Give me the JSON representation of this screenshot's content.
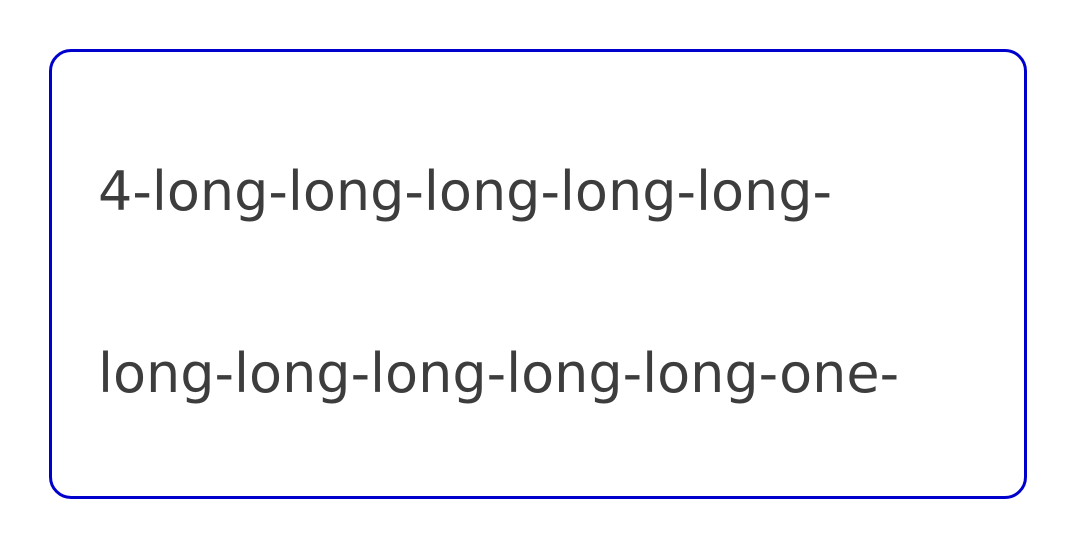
{
  "card": {
    "border_color": "#0000cc",
    "text_color": "#3d3d3d",
    "lines": [
      "4-long-long-long-long-long-",
      "long-long-long-long-long-one-"
    ]
  }
}
